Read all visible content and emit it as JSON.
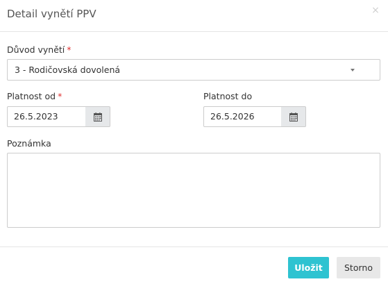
{
  "dialog": {
    "title": "Detail vynětí PPV",
    "close_glyph": "×"
  },
  "form": {
    "reason": {
      "label": "Důvod vynětí",
      "required_mark": "*",
      "value": "3 - Rodičovská dovolená"
    },
    "valid_from": {
      "label": "Platnost od",
      "required_mark": "*",
      "value": "26.5.2023",
      "icon": "calendar-icon"
    },
    "valid_to": {
      "label": "Platnost do",
      "value": "26.5.2026",
      "icon": "calendar-icon"
    },
    "note": {
      "label": "Poznámka",
      "value": ""
    }
  },
  "footer": {
    "save_label": "Uložit",
    "cancel_label": "Storno"
  },
  "colors": {
    "primary": "#2ec3d1",
    "required": "#e03030",
    "addon_bg": "#e6e8ea"
  }
}
